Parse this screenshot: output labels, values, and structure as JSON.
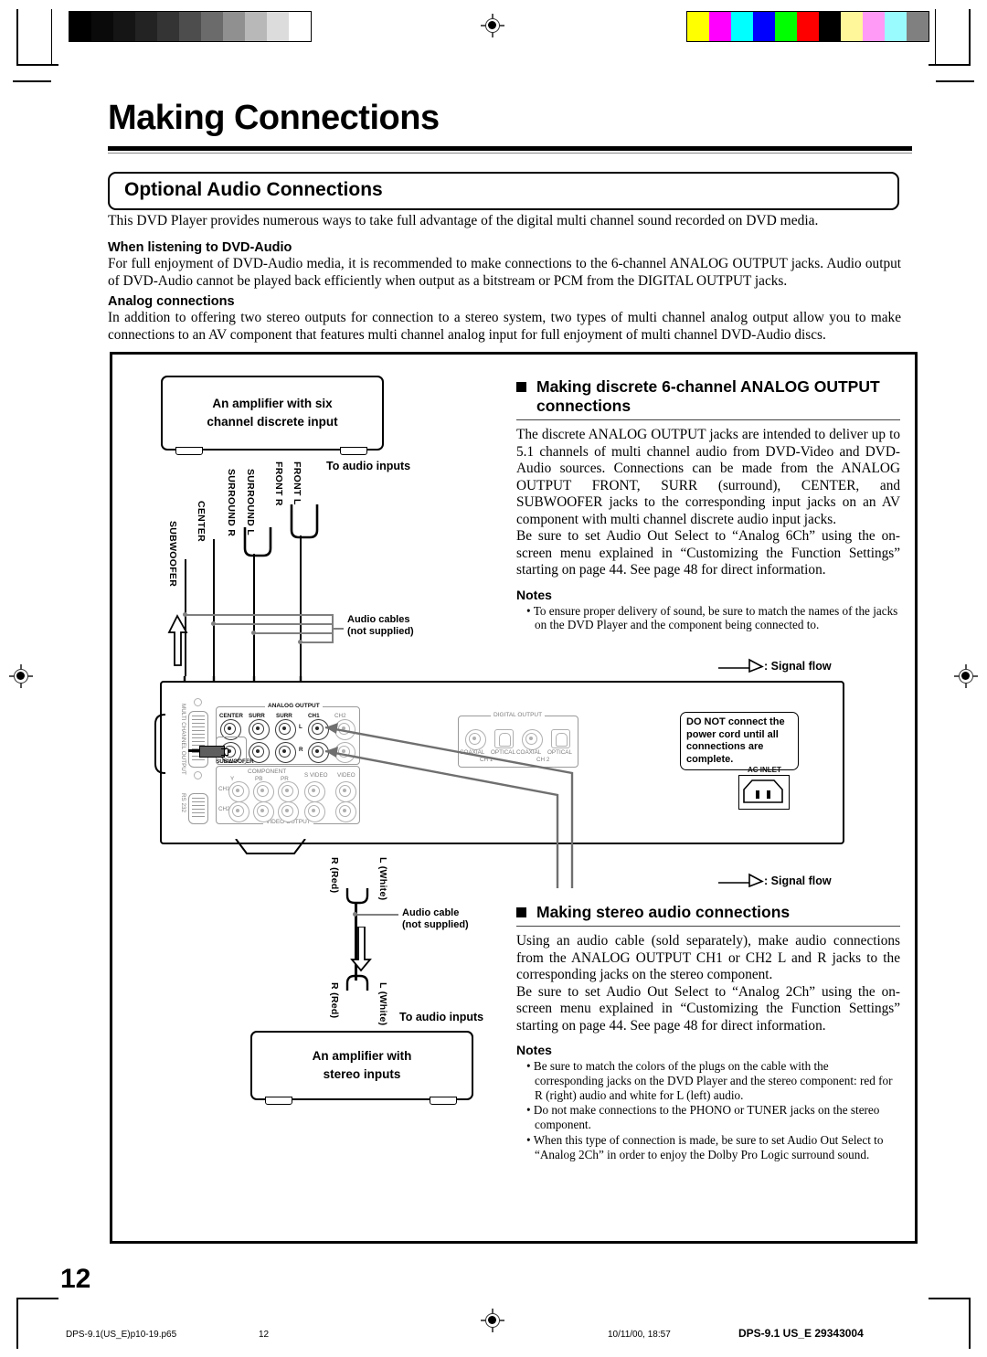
{
  "header": {
    "title": "Making Connections",
    "section_title": "Optional Audio Connections",
    "intro": "This DVD Player provides numerous ways to take full advantage of the digital multi channel sound recorded on DVD media.",
    "sub1_head": "When listening to DVD-Audio",
    "sub1_body": "For full enjoyment of DVD-Audio media, it is recommended to make connections to the 6-channel ANALOG OUTPUT jacks. Audio output of DVD-Audio cannot be played back efficiently when output as a bitstream or PCM from the DIGITAL OUTPUT jacks.",
    "sub2_head": "Analog connections",
    "sub2_body": "In addition to offering two stereo outputs for connection to a stereo system, two types of multi channel analog output allow you to make connections to an AV component that features multi channel analog input for full enjoyment of multi channel DVD-Audio discs."
  },
  "six_channel": {
    "heading": "Making discrete 6-channel ANALOG OUTPUT connections",
    "body": "The discrete ANALOG OUTPUT jacks are intended to deliver up to 5.1 channels of multi channel audio from DVD-Video and DVD-Audio sources. Connections can be made from the ANALOG OUTPUT FRONT, SURR (surround), CENTER, and SUBWOOFER jacks to the corresponding input jacks on an AV component with multi channel discrete audio input jacks.",
    "body2": "Be sure to set Audio Out Select to “Analog 6Ch” using the on-screen menu explained in “Customizing the Function Settings” starting on page 44. See page 48 for direct information.",
    "notes_heading": "Notes",
    "notes": [
      "To ensure proper delivery of sound, be sure to match the names of the jacks on the DVD Player and the component being connected to."
    ]
  },
  "stereo": {
    "heading": "Making stereo audio connections",
    "body": "Using an audio cable (sold separately), make audio connections from the ANALOG OUTPUT CH1 or CH2 L and R jacks to the corresponding jacks on the stereo component.",
    "body2": "Be sure to set Audio Out Select to “Analog 2Ch” using the on-screen menu explained in “Customizing the Function Settings” starting on page 44. See page 48 for direct information.",
    "notes_heading": "Notes",
    "notes": [
      "Be sure to match the colors of the plugs on the cable with the corresponding jacks on the DVD Player and the stereo component: red for R (right) audio and white for L (left) audio.",
      "Do not make connections to the PHONO or TUNER jacks on the stereo component.",
      "When this type of connection is made, be sure to set Audio Out Select to “Analog 2Ch” in order to enjoy the Dolby Pro Logic surround sound."
    ]
  },
  "diagram": {
    "amp_six_line1": "An amplifier with six",
    "amp_six_line2": "channel discrete input",
    "amp_stereo_line1": "An amplifier with",
    "amp_stereo_line2": "stereo inputs",
    "to_audio_inputs": "To audio inputs",
    "audio_cables_line1": "Audio cables",
    "audio_cables_line2": "(not supplied)",
    "audio_cable_line1": "Audio cable",
    "audio_cable_line2": "(not supplied)",
    "signal_flow": ": Signal flow",
    "channel_labels": [
      "SUBWOOFER",
      "CENTER",
      "SURROUND R",
      "SURROUND L",
      "FRONT R",
      "FRONT L"
    ],
    "stereo_plug_r": "R (Red)",
    "stereo_plug_l": "L (White)",
    "warning": "DO NOT connect the power cord until all connections are complete.",
    "ac_inlet": "AC INLET"
  },
  "rear_panel": {
    "multi_ch_output": "MULTI CHANNEL OUTPUT",
    "rs232": "RS 232",
    "analog_output_title": "ANALOG OUTPUT",
    "analog_labels": [
      "CENTER",
      "SURR",
      "SURR",
      "CH1",
      "CH2"
    ],
    "subwoofer": "SUBWOOFER",
    "row_l": "L",
    "row_r": "R",
    "video_output_title": "VIDEO OUTPUT",
    "component_title": "COMPONENT",
    "component_labels": [
      "Y",
      "PB",
      "PR"
    ],
    "s_video": "S VIDEO",
    "video": "VIDEO",
    "ch1": "CH1",
    "ch2": "CH2",
    "digital_output_title": "DIGITAL OUTPUT",
    "digital_labels": [
      "COAXIAL",
      "OPTICAL",
      "COAXIAL",
      "OPTICAL"
    ],
    "digital_ch1": "CH 1",
    "digital_ch2": "CH 2"
  },
  "footer": {
    "page_number": "12",
    "file_name": "DPS-9.1(US_E)p10-19.p65",
    "sheet_number": "12",
    "timestamp": "10/11/00, 18:57",
    "doc_id": "DPS-9.1 US_E   29343004"
  },
  "print_bars": {
    "gray": [
      "#000000",
      "#0a0a0a",
      "#151515",
      "#232323",
      "#343434",
      "#4d4d4d",
      "#6b6b6b",
      "#909090",
      "#b8b8b8",
      "#dcdcdc",
      "#ffffff"
    ],
    "color": [
      "#ffff00",
      "#ff00ff",
      "#00ffff",
      "#0000ff",
      "#00ff00",
      "#ff0000",
      "#000000",
      "#fff79a",
      "#ff9af7",
      "#9afbff",
      "#808080"
    ]
  }
}
